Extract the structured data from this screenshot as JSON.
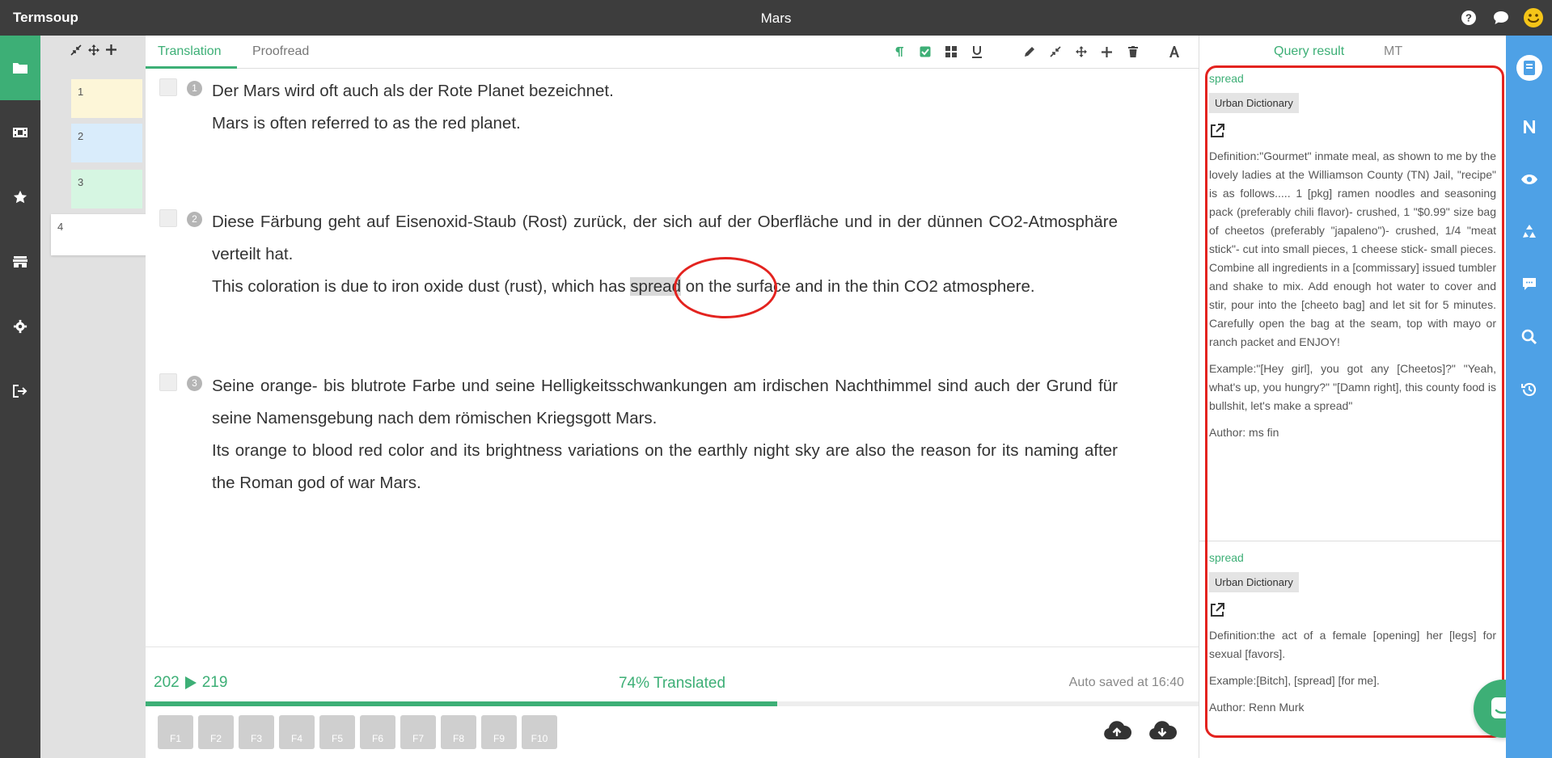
{
  "app": {
    "brand": "Termsoup",
    "document_title": "Mars"
  },
  "top_icons": [
    "help-icon",
    "chat-icon",
    "smiley-icon"
  ],
  "left_nav": [
    "folder-icon",
    "film-icon",
    "star-icon",
    "store-icon",
    "gear-icon",
    "logout-icon"
  ],
  "segment_column": {
    "tools": [
      "collapse-icon",
      "move-icon",
      "plus-icon"
    ],
    "boxes": [
      "1",
      "2",
      "3",
      "4"
    ]
  },
  "editor": {
    "tabs": {
      "translation": "Translation",
      "proofread": "Proofread"
    },
    "toolbar": [
      "pilcrow-icon",
      "check-icon",
      "grid-icon",
      "underline-icon",
      "pencil-icon",
      "collapse-icon",
      "move-icon",
      "plus-icon",
      "trash-icon",
      "font-icon"
    ],
    "segments": [
      {
        "num": "1",
        "source": "Der Mars wird oft auch als der Rote Planet bezeichnet.",
        "target": "Mars is often referred to as the red planet."
      },
      {
        "num": "2",
        "source": "Diese Färbung geht auf Eisenoxid-Staub (Rost) zurück, der sich auf der Oberfläche und in der dünnen CO2-Atmosphäre verteilt hat.",
        "target_pre": "This coloration is due to iron oxide dust (rust), which has ",
        "target_hl": "spread",
        "target_post": " on the surface and in the thin CO2 atmosphere."
      },
      {
        "num": "3",
        "source": "Seine orange- bis blutrote Farbe und seine Helligkeitsschwankungen am irdischen Nachthimmel sind auch der Grund für seine Namensgebung nach dem römischen Kriegsgott Mars.",
        "target": "Its orange to blood red color and its brightness variations on the earthly night sky are also the reason for its naming after the Roman god of war Mars."
      }
    ],
    "status": {
      "count_source": "202",
      "count_target": "219",
      "translated": "74% Translated",
      "autosave": "Auto saved at 16:40",
      "progress": 0.6
    },
    "fkeys": [
      "F1",
      "F2",
      "F3",
      "F4",
      "F5",
      "F6",
      "F7",
      "F8",
      "F9",
      "F10"
    ]
  },
  "right_panel": {
    "tabs": {
      "query": "Query result",
      "mt": "MT"
    },
    "results": [
      {
        "term": "spread",
        "source": "Urban Dictionary",
        "definition": "Definition:\"Gourmet\" inmate meal, as shown to me by the lovely ladies at the Williamson County (TN) Jail, \"recipe\" is as follows..... 1 [pkg] ramen noodles and seasoning pack (preferably chili flavor)- crushed, 1 \"$0.99\" size bag of cheetos (preferably \"japaleno\")- crushed, 1/4 \"meat stick\"- cut into small pieces, 1 cheese stick- small pieces. Combine all ingredients in a [commissary] issued tumbler and shake to mix. Add enough hot water to cover and stir, pour into the [cheeto bag] and let sit for 5 minutes. Carefully open the bag at the seam, top with mayo or ranch packet and ENJOY!",
        "example": "Example:\"[Hey girl], you got any [Cheetos]?\" \"Yeah, what's up, you hungry?\" \"[Damn right], this county food is bullshit, let's make a spread\"",
        "author": "Author: ms fin"
      },
      {
        "term": "spread",
        "source": "Urban Dictionary",
        "definition": "Definition:the act of a female [opening] her [legs] for sexual [favors].",
        "example": "Example:[Bitch], [spread] [for me].",
        "author": "Author: Renn Murk"
      }
    ]
  },
  "right_nav": [
    "notebook-icon",
    "n-icon",
    "eye-icon",
    "recycle-icon",
    "comment-icon",
    "search-icon",
    "history-icon"
  ],
  "colors": {
    "accent_green": "#3daf76",
    "dark_bar": "#3d3d3d",
    "blue_bar": "#4ea1e6",
    "annotation_red": "#e3231f"
  }
}
